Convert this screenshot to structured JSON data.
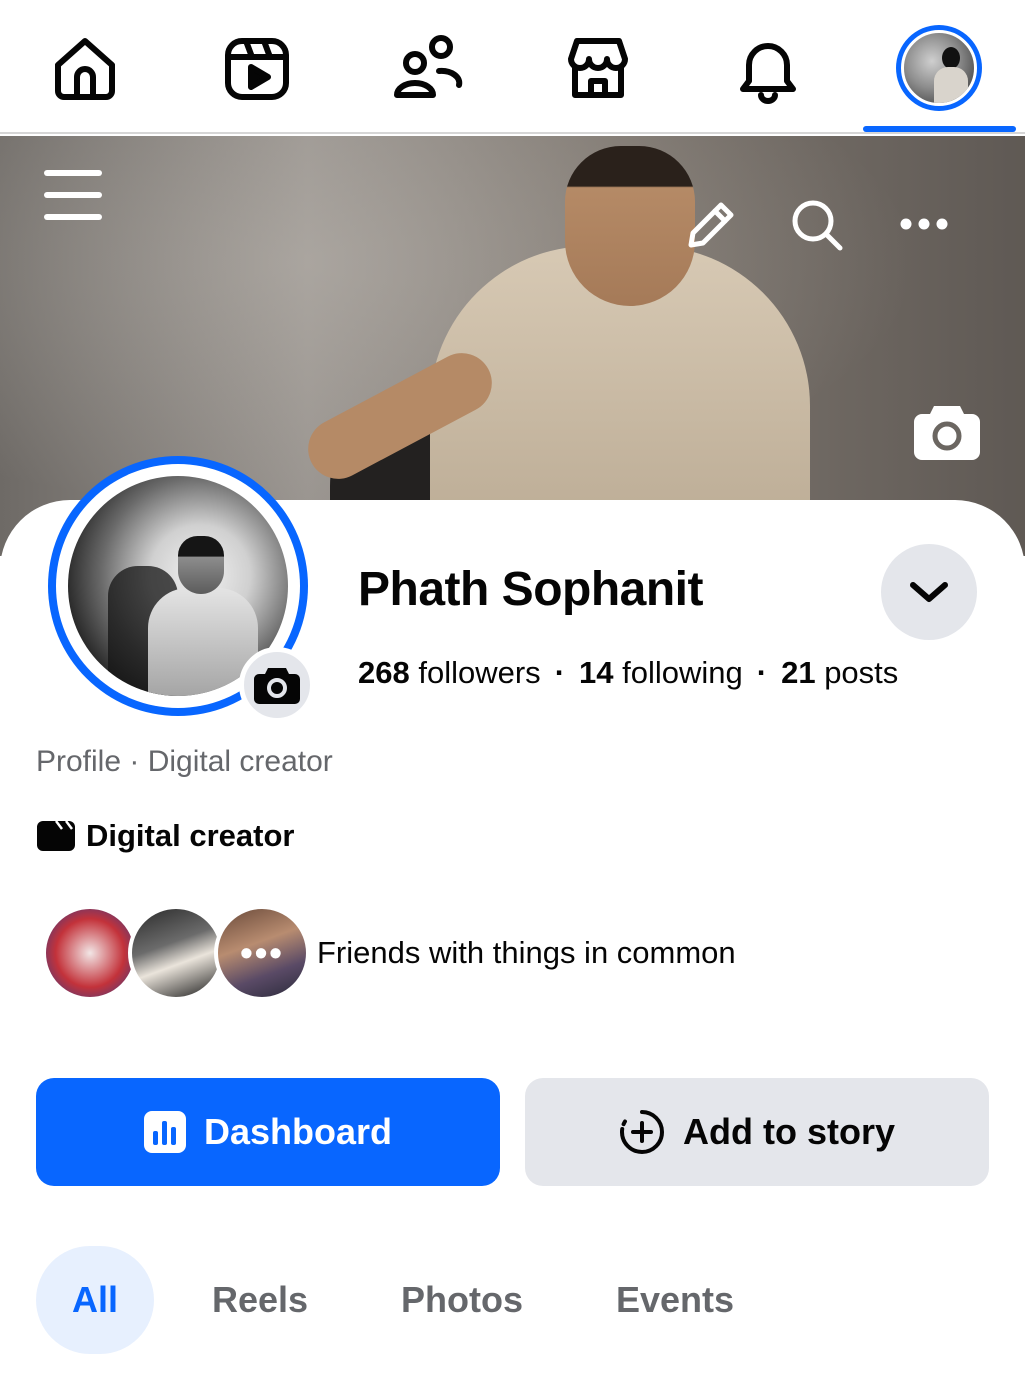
{
  "nav": {
    "items": [
      {
        "name": "home",
        "icon": "home-icon"
      },
      {
        "name": "reels",
        "icon": "reels-icon"
      },
      {
        "name": "friends",
        "icon": "friends-icon"
      },
      {
        "name": "marketplace",
        "icon": "marketplace-icon"
      },
      {
        "name": "notifications",
        "icon": "bell-icon"
      },
      {
        "name": "profile",
        "icon": "avatar",
        "active": true
      }
    ],
    "active_color": "#0866ff"
  },
  "cover": {
    "icons": [
      "menu-icon",
      "pencil-icon",
      "search-icon",
      "more-icon",
      "camera-icon"
    ]
  },
  "profile": {
    "name": "Phath Sophanit",
    "followers_count": "268",
    "followers_label": "followers",
    "following_count": "14",
    "following_label": "following",
    "posts_count": "21",
    "posts_label": "posts",
    "separator": "·",
    "subtitle": "Profile · Digital creator",
    "category": "Digital creator"
  },
  "friends": {
    "text": "Friends with things in common",
    "more_glyph": "•••"
  },
  "actions": {
    "dashboard_label": "Dashboard",
    "add_story_label": "Add to story"
  },
  "tabs": [
    {
      "label": "All",
      "active": true
    },
    {
      "label": "Reels"
    },
    {
      "label": "Photos"
    },
    {
      "label": "Events"
    }
  ],
  "colors": {
    "brand": "#0866ff",
    "secondary_button": "#e4e6eb",
    "muted_text": "#65676b",
    "active_tab_bg": "#e7f0fe"
  }
}
